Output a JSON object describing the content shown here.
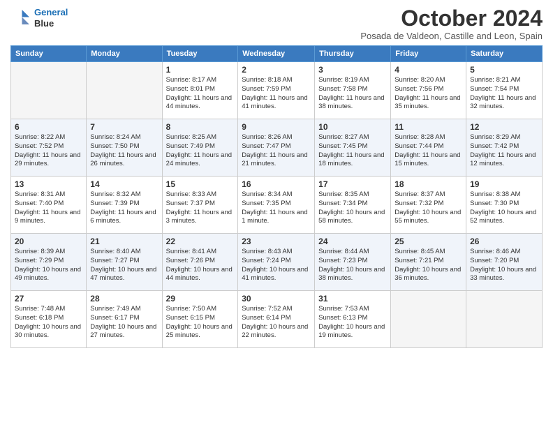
{
  "header": {
    "logo_line1": "General",
    "logo_line2": "Blue",
    "month_title": "October 2024",
    "subtitle": "Posada de Valdeon, Castille and Leon, Spain"
  },
  "weekdays": [
    "Sunday",
    "Monday",
    "Tuesday",
    "Wednesday",
    "Thursday",
    "Friday",
    "Saturday"
  ],
  "weeks": [
    [
      {
        "day": "",
        "empty": true
      },
      {
        "day": "",
        "empty": true
      },
      {
        "day": "1",
        "sunrise": "8:17 AM",
        "sunset": "8:01 PM",
        "daylight": "11 hours and 44 minutes."
      },
      {
        "day": "2",
        "sunrise": "8:18 AM",
        "sunset": "7:59 PM",
        "daylight": "11 hours and 41 minutes."
      },
      {
        "day": "3",
        "sunrise": "8:19 AM",
        "sunset": "7:58 PM",
        "daylight": "11 hours and 38 minutes."
      },
      {
        "day": "4",
        "sunrise": "8:20 AM",
        "sunset": "7:56 PM",
        "daylight": "11 hours and 35 minutes."
      },
      {
        "day": "5",
        "sunrise": "8:21 AM",
        "sunset": "7:54 PM",
        "daylight": "11 hours and 32 minutes."
      }
    ],
    [
      {
        "day": "6",
        "sunrise": "8:22 AM",
        "sunset": "7:52 PM",
        "daylight": "11 hours and 29 minutes."
      },
      {
        "day": "7",
        "sunrise": "8:24 AM",
        "sunset": "7:50 PM",
        "daylight": "11 hours and 26 minutes."
      },
      {
        "day": "8",
        "sunrise": "8:25 AM",
        "sunset": "7:49 PM",
        "daylight": "11 hours and 24 minutes."
      },
      {
        "day": "9",
        "sunrise": "8:26 AM",
        "sunset": "7:47 PM",
        "daylight": "11 hours and 21 minutes."
      },
      {
        "day": "10",
        "sunrise": "8:27 AM",
        "sunset": "7:45 PM",
        "daylight": "11 hours and 18 minutes."
      },
      {
        "day": "11",
        "sunrise": "8:28 AM",
        "sunset": "7:44 PM",
        "daylight": "11 hours and 15 minutes."
      },
      {
        "day": "12",
        "sunrise": "8:29 AM",
        "sunset": "7:42 PM",
        "daylight": "11 hours and 12 minutes."
      }
    ],
    [
      {
        "day": "13",
        "sunrise": "8:31 AM",
        "sunset": "7:40 PM",
        "daylight": "11 hours and 9 minutes."
      },
      {
        "day": "14",
        "sunrise": "8:32 AM",
        "sunset": "7:39 PM",
        "daylight": "11 hours and 6 minutes."
      },
      {
        "day": "15",
        "sunrise": "8:33 AM",
        "sunset": "7:37 PM",
        "daylight": "11 hours and 3 minutes."
      },
      {
        "day": "16",
        "sunrise": "8:34 AM",
        "sunset": "7:35 PM",
        "daylight": "11 hours and 1 minute."
      },
      {
        "day": "17",
        "sunrise": "8:35 AM",
        "sunset": "7:34 PM",
        "daylight": "10 hours and 58 minutes."
      },
      {
        "day": "18",
        "sunrise": "8:37 AM",
        "sunset": "7:32 PM",
        "daylight": "10 hours and 55 minutes."
      },
      {
        "day": "19",
        "sunrise": "8:38 AM",
        "sunset": "7:30 PM",
        "daylight": "10 hours and 52 minutes."
      }
    ],
    [
      {
        "day": "20",
        "sunrise": "8:39 AM",
        "sunset": "7:29 PM",
        "daylight": "10 hours and 49 minutes."
      },
      {
        "day": "21",
        "sunrise": "8:40 AM",
        "sunset": "7:27 PM",
        "daylight": "10 hours and 47 minutes."
      },
      {
        "day": "22",
        "sunrise": "8:41 AM",
        "sunset": "7:26 PM",
        "daylight": "10 hours and 44 minutes."
      },
      {
        "day": "23",
        "sunrise": "8:43 AM",
        "sunset": "7:24 PM",
        "daylight": "10 hours and 41 minutes."
      },
      {
        "day": "24",
        "sunrise": "8:44 AM",
        "sunset": "7:23 PM",
        "daylight": "10 hours and 38 minutes."
      },
      {
        "day": "25",
        "sunrise": "8:45 AM",
        "sunset": "7:21 PM",
        "daylight": "10 hours and 36 minutes."
      },
      {
        "day": "26",
        "sunrise": "8:46 AM",
        "sunset": "7:20 PM",
        "daylight": "10 hours and 33 minutes."
      }
    ],
    [
      {
        "day": "27",
        "sunrise": "7:48 AM",
        "sunset": "6:18 PM",
        "daylight": "10 hours and 30 minutes."
      },
      {
        "day": "28",
        "sunrise": "7:49 AM",
        "sunset": "6:17 PM",
        "daylight": "10 hours and 27 minutes."
      },
      {
        "day": "29",
        "sunrise": "7:50 AM",
        "sunset": "6:15 PM",
        "daylight": "10 hours and 25 minutes."
      },
      {
        "day": "30",
        "sunrise": "7:52 AM",
        "sunset": "6:14 PM",
        "daylight": "10 hours and 22 minutes."
      },
      {
        "day": "31",
        "sunrise": "7:53 AM",
        "sunset": "6:13 PM",
        "daylight": "10 hours and 19 minutes."
      },
      {
        "day": "",
        "empty": true
      },
      {
        "day": "",
        "empty": true
      }
    ]
  ]
}
